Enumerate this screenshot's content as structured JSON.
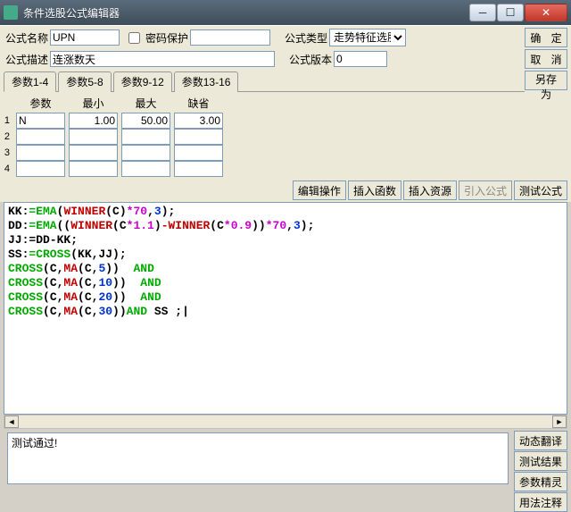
{
  "window": {
    "title": "条件选股公式编辑器"
  },
  "labels": {
    "name": "公式名称",
    "password": "密码保护",
    "type": "公式类型",
    "desc": "公式描述",
    "version": "公式版本"
  },
  "fields": {
    "name": "UPN",
    "desc": "连涨数天",
    "type": "走势特征选股",
    "version": "0",
    "password": ""
  },
  "buttons": {
    "ok": "确 定",
    "cancel": "取 消",
    "saveas": "另存为",
    "edit": "编辑操作",
    "insertFn": "插入函数",
    "insertRes": "插入资源",
    "import": "引入公式",
    "test": "测试公式",
    "dynTranslate": "动态翻译",
    "testResult": "测试结果",
    "paramWizard": "参数精灵",
    "usageNote": "用法注释"
  },
  "tabs": [
    "参数1-4",
    "参数5-8",
    "参数9-12",
    "参数13-16"
  ],
  "paramHeaders": {
    "name": "参数",
    "min": "最小",
    "max": "最大",
    "default": "缺省"
  },
  "params": [
    {
      "name": "N",
      "min": "1.00",
      "max": "50.00",
      "def": "3.00"
    },
    {
      "name": "",
      "min": "",
      "max": "",
      "def": ""
    },
    {
      "name": "",
      "min": "",
      "max": "",
      "def": ""
    },
    {
      "name": "",
      "min": "",
      "max": "",
      "def": ""
    }
  ],
  "rowNums": [
    "1",
    "2",
    "3",
    "4"
  ],
  "output": "测试通过!",
  "code": {
    "l1a": "KK:",
    "l1b": "=EMA",
    "l1c": "(",
    "l1d": "WINNER",
    "l1e": "(C)",
    "l1f": "*70",
    "l1g": ",",
    "l1h": "3",
    "l1i": ");",
    "l2a": "DD:",
    "l2b": "=EMA",
    "l2c": "((",
    "l2d": "WINNER",
    "l2e": "(C",
    "l2f": "*1.1",
    "l2g": ")",
    "l2h": "-WINNER",
    "l2i": "(C",
    "l2j": "*0.9",
    "l2k": "))",
    "l2l": "*70",
    "l2m": ",",
    "l2n": "3",
    "l2o": ");",
    "l3": "JJ:=DD-KK;",
    "l4a": "SS:",
    "l4b": "=CROSS",
    "l4c": "(KK,JJ);",
    "l5a": "CROSS",
    "l5b": "(C,",
    "l5c": "MA",
    "l5d": "(C,",
    "l5e": "5",
    "l5f": "))  ",
    "l5g": "AND",
    "l6a": "CROSS",
    "l6b": "(C,",
    "l6c": "MA",
    "l6d": "(C,",
    "l6e": "10",
    "l6f": "))  ",
    "l6g": "AND",
    "l7a": "CROSS",
    "l7b": "(C,",
    "l7c": "MA",
    "l7d": "(C,",
    "l7e": "20",
    "l7f": "))  ",
    "l7g": "AND",
    "l8a": "CROSS",
    "l8b": "(C,",
    "l8c": "MA",
    "l8d": "(C,",
    "l8e": "30",
    "l8f": "))",
    "l8g": "AND ",
    "l8h": "SS ;"
  }
}
